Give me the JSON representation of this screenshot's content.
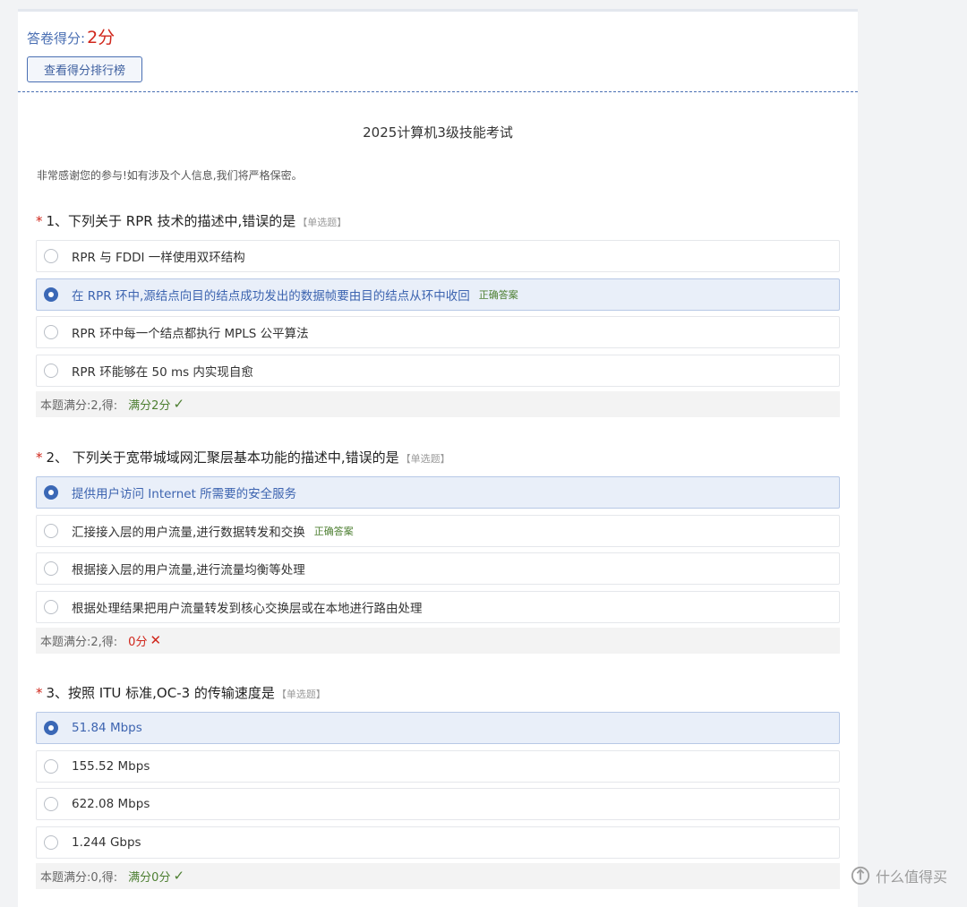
{
  "header": {
    "score_label": "答卷得分:",
    "score_value": "2分",
    "rank_button": "查看得分排行榜"
  },
  "survey": {
    "title": "2025计算机3级技能考试",
    "description": "非常感谢您的参与!如有涉及个人信息,我们将严格保密。"
  },
  "questions": [
    {
      "required": "*",
      "title": "1、下列关于 RPR 技术的描述中,错误的是",
      "type": "【单选题】",
      "options": [
        {
          "label": "RPR 与 FDDI 一样使用双环结构",
          "selected": false,
          "correct_tag": ""
        },
        {
          "label": "在 RPR 环中,源结点向目的结点成功发出的数据帧要由目的结点从环中收回",
          "selected": true,
          "correct_tag": "正确答案"
        },
        {
          "label": "RPR 环中每一个结点都执行 MPLS 公平算法",
          "selected": false,
          "correct_tag": ""
        },
        {
          "label": "RPR 环能够在 50 ms 内实现自愈",
          "selected": false,
          "correct_tag": ""
        }
      ],
      "score_text": "本题满分:2,得:",
      "result_text": "满分2分",
      "result_mark": "✓",
      "result_ok": true
    },
    {
      "required": "*",
      "title": "2、 下列关于宽带城域网汇聚层基本功能的描述中,错误的是",
      "type": "【单选题】",
      "options": [
        {
          "label": "提供用户访问 Internet 所需要的安全服务",
          "selected": true,
          "correct_tag": ""
        },
        {
          "label": "汇接接入层的用户流量,进行数据转发和交换",
          "selected": false,
          "correct_tag": "正确答案"
        },
        {
          "label": "根据接入层的用户流量,进行流量均衡等处理",
          "selected": false,
          "correct_tag": ""
        },
        {
          "label": "根据处理结果把用户流量转发到核心交换层或在本地进行路由处理",
          "selected": false,
          "correct_tag": ""
        }
      ],
      "score_text": "本题满分:2,得:",
      "result_text": "0分",
      "result_mark": "✕",
      "result_ok": false
    },
    {
      "required": "*",
      "title": "3、按照 ITU 标准,OC-3 的传输速度是",
      "type": "【单选题】",
      "options": [
        {
          "label": "51.84 Mbps",
          "selected": true,
          "correct_tag": ""
        },
        {
          "label": "155.52 Mbps",
          "selected": false,
          "correct_tag": ""
        },
        {
          "label": "622.08 Mbps",
          "selected": false,
          "correct_tag": ""
        },
        {
          "label": "1.244 Gbps",
          "selected": false,
          "correct_tag": ""
        }
      ],
      "score_text": "本题满分:0,得:",
      "result_text": "满分0分",
      "result_mark": "✓",
      "result_ok": true
    }
  ],
  "watermark": {
    "text": "什么值得买",
    "icon": "smzdm-logo-icon"
  },
  "colors": {
    "accent": "#3b68b6",
    "error": "#d0271c",
    "success": "#4d7f31"
  }
}
